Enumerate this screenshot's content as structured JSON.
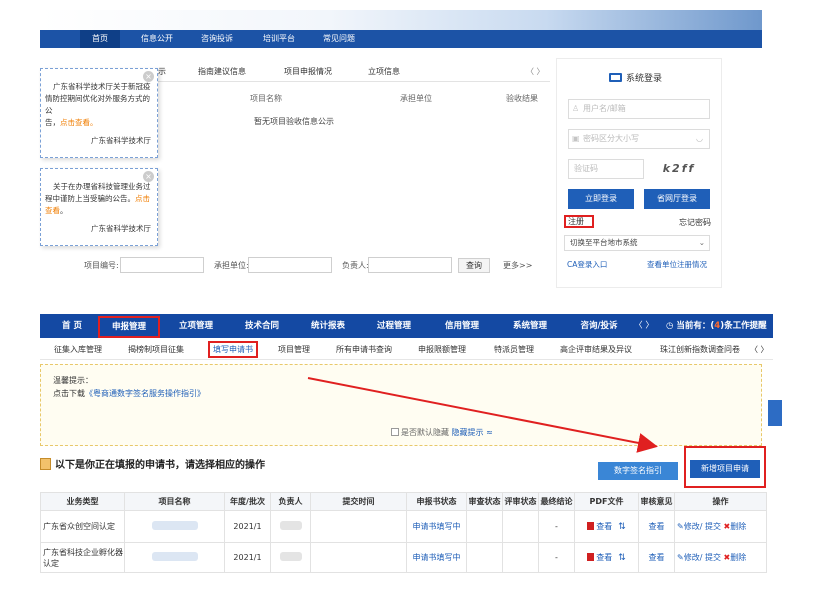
{
  "top": {
    "nav": [
      "首页",
      "信息公开",
      "咨询投诉",
      "培训平台",
      "常见问题"
    ],
    "tabs": [
      "示",
      "指南建议信息",
      "项目申报情况",
      "立项信息"
    ],
    "tab_arrows": "〈 〉",
    "table_headers": [
      "项目名称",
      "承担单位",
      "验收结果"
    ],
    "no_info": "暂无项目验收信息公示",
    "popup1": {
      "text_a": "广东省科学技术厅关于新冠疫",
      "text_b": "情防控期间优化对外服务方式的公",
      "text_c": "告，",
      "link": "点击查看。",
      "sign": "广东省科学技术厅"
    },
    "popup2": {
      "text_a": "关于在办理省科技管理业务过",
      "text_b": "程中谨防上当受骗的公告。",
      "link": "点击查看",
      "text_c": "。",
      "sign": "广东省科学技术厅"
    },
    "search": {
      "code_label": "项目编号:",
      "unit_label": "承担单位:",
      "person_label": "负责人:",
      "query": "查询",
      "more": "更多>>"
    },
    "login": {
      "title": "系统登录",
      "user_placeholder": "用户名/邮箱",
      "pwd_placeholder": "密码区分大小写",
      "captcha_placeholder": "验证码",
      "captcha": "k2ff",
      "login_btn": "立即登录",
      "province_btn": "省网厅登录",
      "register": "注册",
      "forgot": "忘记密码",
      "switch": "切换至平台地市系统",
      "ca": "CA登录入口",
      "query_unit": "查看单位注册情况"
    }
  },
  "bottom": {
    "nav": [
      "首 页",
      "申报管理",
      "立项管理",
      "技术合同",
      "统计报表",
      "过程管理",
      "信用管理",
      "系统管理",
      "咨询/投诉"
    ],
    "nav_arrows": "〈 〉",
    "notice_prefix": "当前有：(",
    "notice_count": "4",
    "notice_suffix": ")条工作提醒",
    "subnav": [
      "征集入库管理",
      "揭榜制项目征集",
      "填写申请书",
      "项目管理",
      "所有申请书查询",
      "申报限额管理",
      "特派员管理",
      "高企评审结果及异议",
      "珠江创新指数调查问卷"
    ],
    "subnav_arrows": "〈 〉",
    "tip": {
      "title": "温馨提示：",
      "prefix": "点击下载",
      "link": "《粤商通数字签名服务操作指引》",
      "hide_label": "是否默认隐藏",
      "hide_link": "隐藏提示 ≈"
    },
    "heading": "以下是你正在填报的申请书，请选择相应的操作",
    "btn_sign": "数字签名指引",
    "btn_new": "新增项目申请",
    "columns": [
      "业务类型",
      "项目名称",
      "年度/批次",
      "负责人",
      "提交时间",
      "申报书状态",
      "审查状态",
      "评审状态",
      "最终结论",
      "PDF文件",
      "审核意见",
      "操作"
    ],
    "rows": [
      {
        "type": "广东省众创空间认定",
        "year": "2021/1",
        "status": "申请书填写中",
        "conclusion": "-",
        "pdf": "查看",
        "review": "查看",
        "op_edit": "修改/",
        "op_submit": "提交",
        "op_delete": "删除"
      },
      {
        "type": "广东省科技企业孵化器认定",
        "year": "2021/1",
        "status": "申请书填写中",
        "conclusion": "-",
        "pdf": "查看",
        "review": "查看",
        "op_edit": "修改/",
        "op_submit": "提交",
        "op_delete": "删除"
      }
    ]
  },
  "colors": {
    "nav_blue": "#1449a3",
    "highlight_red": "#e02020",
    "link_blue": "#1f5fb8",
    "orange": "#f07d00"
  }
}
